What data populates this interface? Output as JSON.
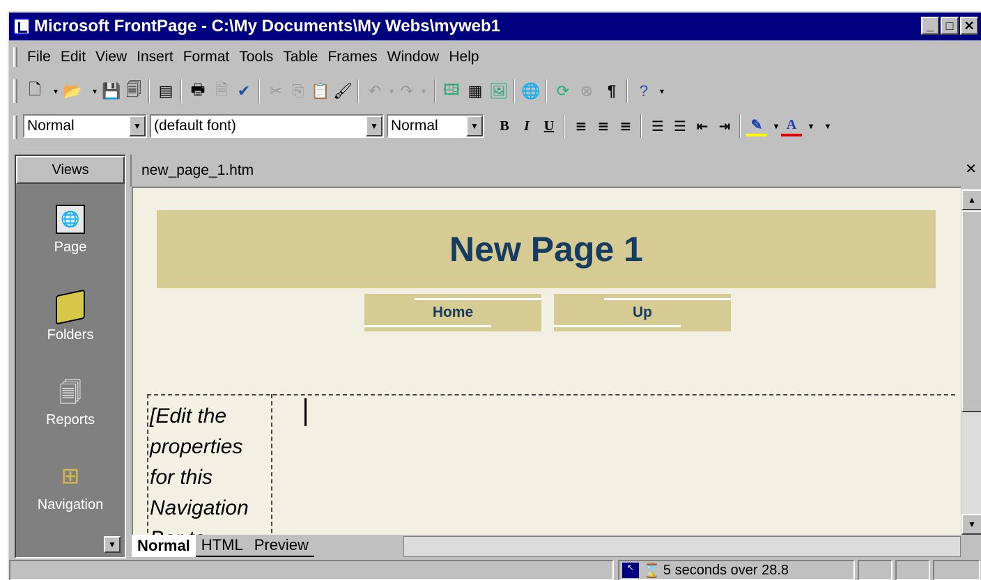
{
  "window": {
    "title": "Microsoft FrontPage - C:\\My Documents\\My Webs\\myweb1"
  },
  "menu": [
    "File",
    "Edit",
    "View",
    "Insert",
    "Format",
    "Tools",
    "Table",
    "Frames",
    "Window",
    "Help"
  ],
  "format_toolbar": {
    "style": "Normal",
    "font": "(default font)",
    "size": "Normal",
    "bold": "B",
    "italic": "I",
    "underline": "U"
  },
  "views": {
    "header": "Views",
    "items": [
      "Page",
      "Folders",
      "Reports",
      "Navigation"
    ]
  },
  "editor": {
    "doc_tab": "new_page_1.htm",
    "banner_title": "New Page 1",
    "nav_buttons": [
      "Home",
      "Up"
    ],
    "navbar_placeholder": "[Edit the properties for this Navigation Bar to..."
  },
  "view_tabs": [
    "Normal",
    "HTML",
    "Preview"
  ],
  "status": {
    "download_time": "5 seconds over 28.8"
  },
  "colors": {
    "banner_bg": "#d6cb93",
    "banner_text": "#173c62",
    "title_bar": "#000080"
  }
}
